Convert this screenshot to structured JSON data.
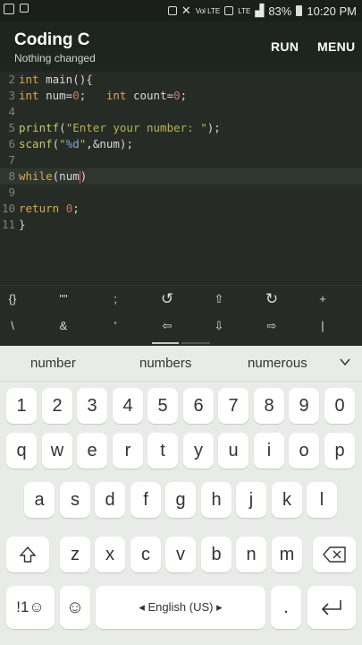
{
  "status_bar": {
    "battery": "83%",
    "time": "10:20 PM",
    "lte": "LTE",
    "volte": "Vol LTE"
  },
  "app": {
    "title": "Coding C",
    "subtitle": "Nothing changed",
    "run": "RUN",
    "menu": "MENU"
  },
  "code_lines": [
    {
      "n": "2"
    },
    {
      "n": "3"
    },
    {
      "n": "4"
    },
    {
      "n": "5"
    },
    {
      "n": "6"
    },
    {
      "n": "7"
    },
    {
      "n": "8"
    },
    {
      "n": "9"
    },
    {
      "n": "10"
    },
    {
      "n": "11"
    }
  ],
  "code": {
    "l2": {
      "kw": "int",
      "rest": " main(){"
    },
    "l3": {
      "kw1": "int",
      "a": " num=",
      "n0": "0",
      "b": ";   ",
      "kw2": "int",
      "c": " count=",
      "n1": "0",
      "d": ";"
    },
    "l5": {
      "fn": "printf",
      "a": "(",
      "s": "\"Enter your number: \"",
      "b": ");"
    },
    "l6": {
      "fn": "scanf",
      "a": "(",
      "q1": "\"",
      "fmt": "%d",
      "q2": "\"",
      "b": ",&num);"
    },
    "l8": {
      "kw": "while",
      "a": "(num",
      "b": ")"
    },
    "l10": {
      "kw": "return",
      "a": " ",
      "n": "0",
      "b": ";"
    },
    "l11": {
      "a": "}"
    }
  },
  "symbols_row1": [
    "{}",
    "\"\"",
    ";",
    "↺",
    "⇧",
    "↻",
    "+"
  ],
  "symbols_row2": [
    "\\",
    "&",
    "'",
    "⇦",
    "⇩",
    "⇨",
    "|"
  ],
  "suggestions": [
    "number",
    "numbers",
    "numerous"
  ],
  "keys": {
    "digits": [
      "1",
      "2",
      "3",
      "4",
      "5",
      "6",
      "7",
      "8",
      "9",
      "0"
    ],
    "row_q": [
      "q",
      "w",
      "e",
      "r",
      "t",
      "y",
      "u",
      "i",
      "o",
      "p"
    ],
    "row_a": [
      "a",
      "s",
      "d",
      "f",
      "g",
      "h",
      "j",
      "k",
      "l"
    ],
    "row_z": [
      "z",
      "x",
      "c",
      "v",
      "b",
      "n",
      "m"
    ],
    "sym": "!1☺",
    "space": "English (US)",
    "period": "."
  }
}
